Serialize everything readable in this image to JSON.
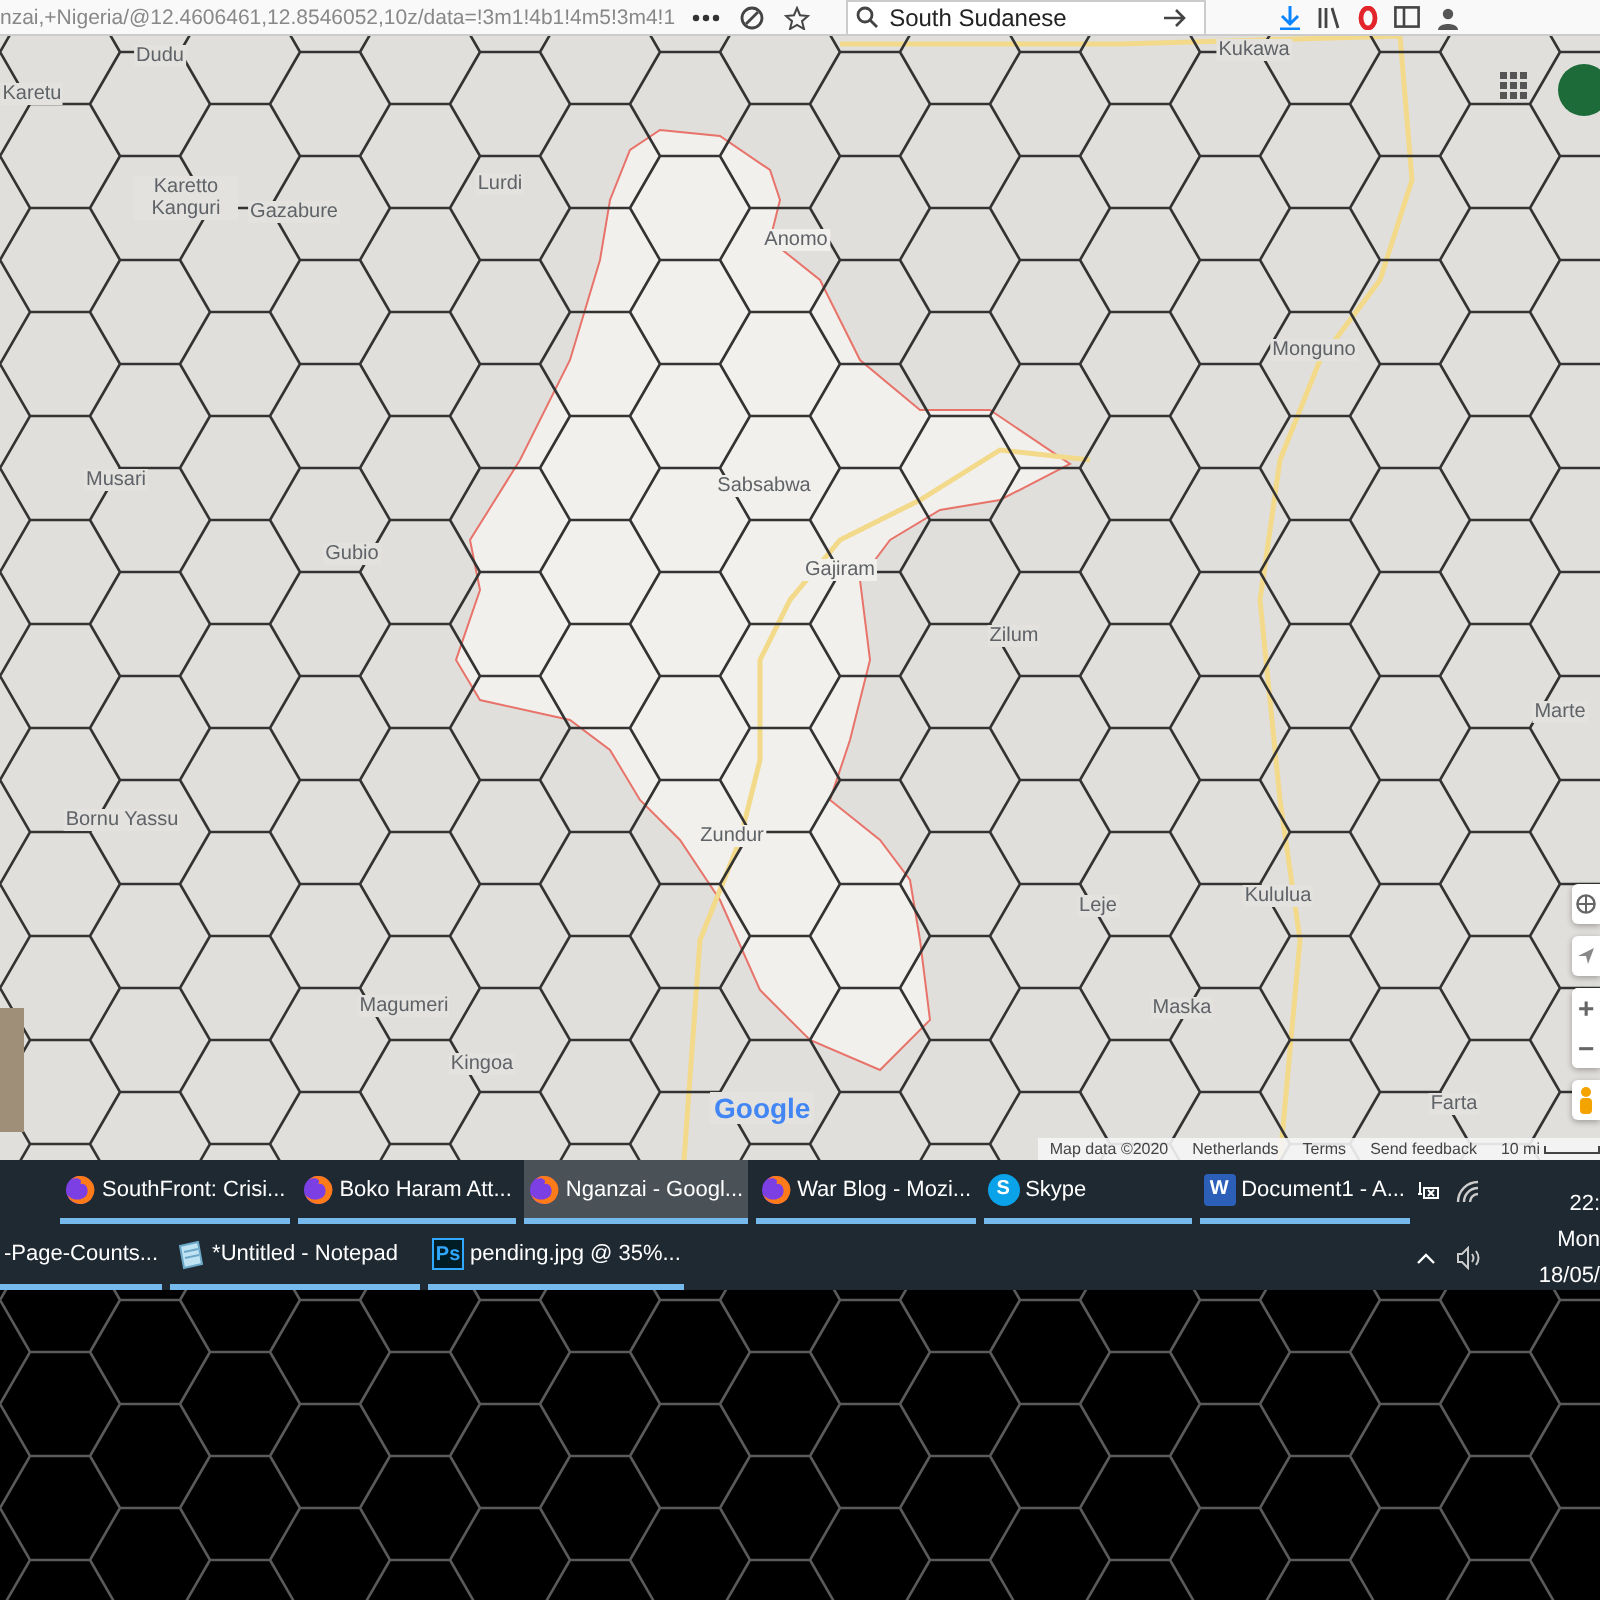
{
  "browser_bar": {
    "url": "nzai,+Nigeria/@12.4606461,12.8546052,10z/data=!3m1!4b1!4m5!3m4!1",
    "search": "South Sudanese"
  },
  "map": {
    "places": [
      {
        "name": "Dudu"
      },
      {
        "name": "Karetu"
      },
      {
        "name": "Kukawa"
      },
      {
        "name": "Karetto Kanguri"
      },
      {
        "name": "Gazabure"
      },
      {
        "name": "Lurdi"
      },
      {
        "name": "Anomo"
      },
      {
        "name": "Monguno"
      },
      {
        "name": "Musari"
      },
      {
        "name": "Sabsabwa"
      },
      {
        "name": "Gubio"
      },
      {
        "name": "Gajiram"
      },
      {
        "name": "Zilum"
      },
      {
        "name": "Marte"
      },
      {
        "name": "Bornu Yassu"
      },
      {
        "name": "Zundur"
      },
      {
        "name": "Leje"
      },
      {
        "name": "Kululua"
      },
      {
        "name": "Magumeri"
      },
      {
        "name": "Maska"
      },
      {
        "name": "Kingoa"
      },
      {
        "name": "Farta"
      }
    ],
    "logo": "Google",
    "attribution": [
      "Map data ©2020",
      "Netherlands",
      "Terms",
      "Send feedback"
    ],
    "scale": "10 mi",
    "zoom_in": "+",
    "zoom_out": "−"
  },
  "taskbar": {
    "top_row": [
      {
        "label": "SouthFront: Crisi...",
        "kind": "firefox",
        "selected": false
      },
      {
        "label": "Boko Haram Att...",
        "kind": "firefox",
        "selected": false
      },
      {
        "label": "Nganzai - Googl...",
        "kind": "firefox",
        "selected": true
      },
      {
        "label": "War Blog - Mozi...",
        "kind": "firefox",
        "selected": false
      },
      {
        "label": "Skype",
        "kind": "skype",
        "badge": "S",
        "selected": false
      },
      {
        "label": "Document1  -  A...",
        "kind": "word",
        "badge": "W",
        "selected": false
      }
    ],
    "bottom_row": [
      {
        "label": "-Page-Counts...",
        "kind": "none",
        "selected": false
      },
      {
        "label": "*Untitled - Notepad",
        "kind": "notepad",
        "selected": false
      },
      {
        "label": "pending.jpg @ 35%...",
        "kind": "photoshop",
        "badge": "Ps",
        "selected": false
      }
    ],
    "tray": {
      "time": "22:",
      "day": "Mon",
      "date": "18/05/"
    }
  }
}
